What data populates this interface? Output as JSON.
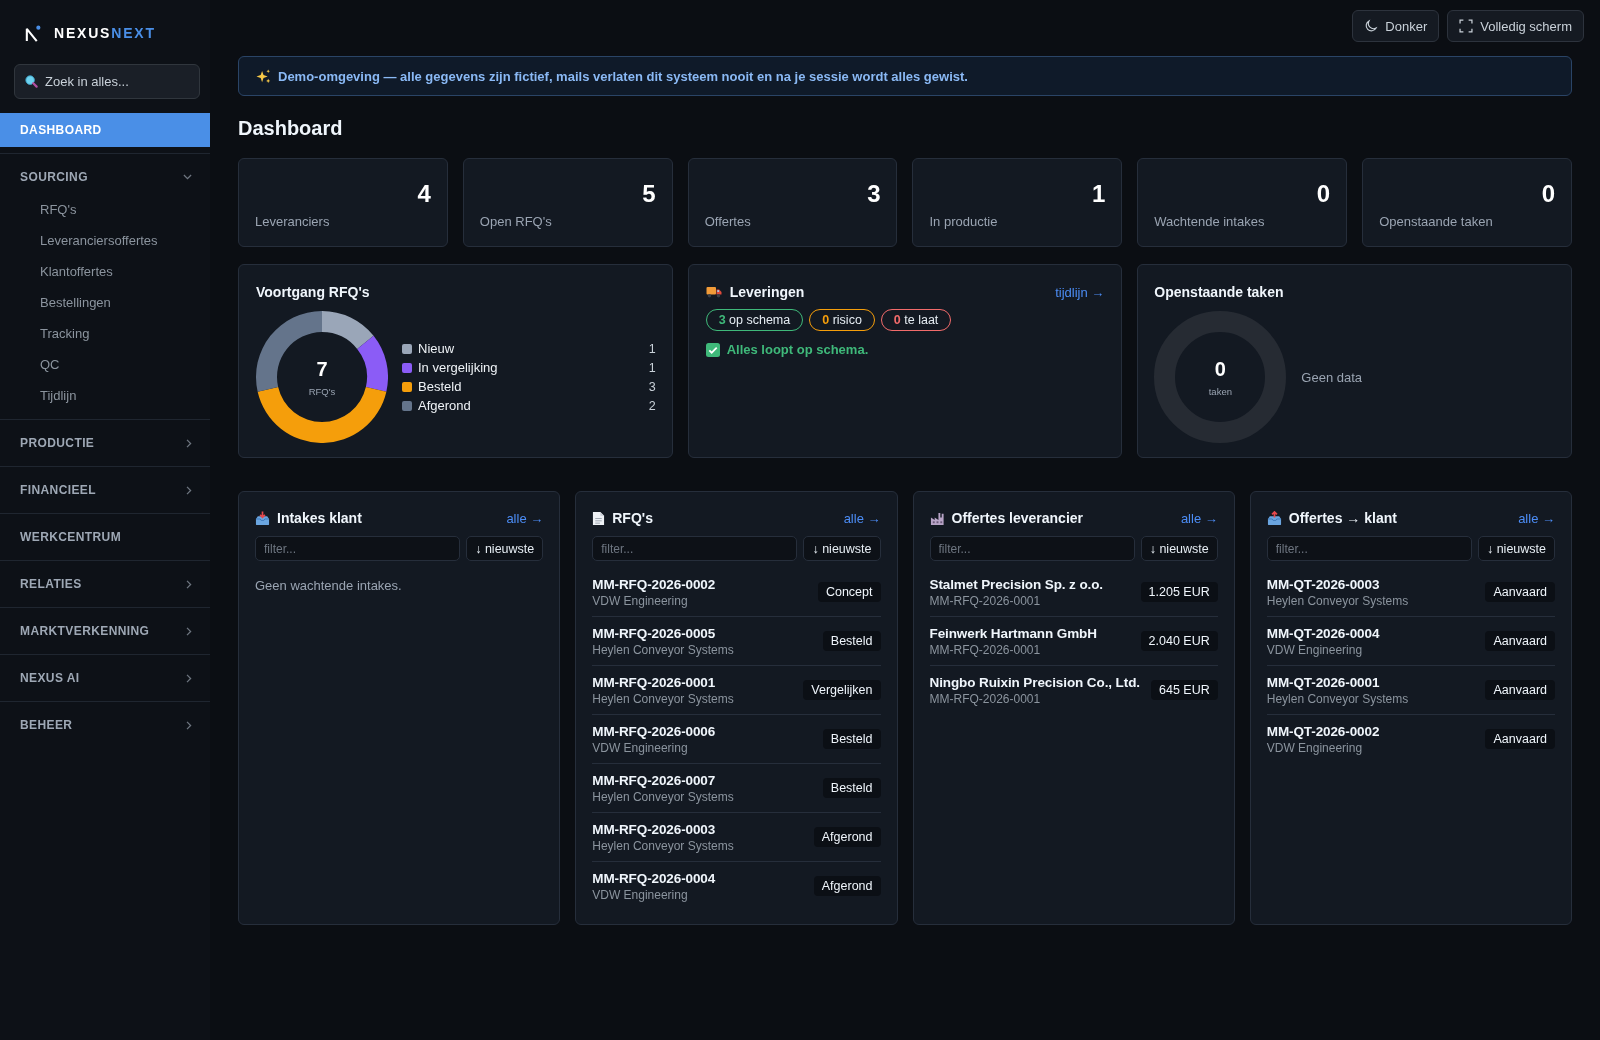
{
  "sidebar": {
    "logo": {
      "primary": "NEXUS",
      "accent": "NEXT"
    },
    "search": {
      "placeholder": "Zoek in alles..."
    },
    "items": [
      {
        "kind": "link",
        "label": "DASHBOARD",
        "selected": true
      },
      {
        "kind": "group",
        "label": "SOURCING",
        "selected": false,
        "expanded": true,
        "children": [
          {
            "label": "RFQ's",
            "selected": false
          },
          {
            "label": "Leveranciersoffertes",
            "selected": false
          },
          {
            "label": "Klantoffertes",
            "selected": false
          },
          {
            "label": "Bestellingen",
            "selected": false
          },
          {
            "label": "Tracking",
            "selected": false
          },
          {
            "label": "QC",
            "selected": false
          },
          {
            "label": "Tijdlijn",
            "selected": false
          }
        ]
      },
      {
        "kind": "group",
        "label": "PRODUCTIE",
        "selected": false,
        "expanded": false
      },
      {
        "kind": "group",
        "label": "FINANCIEEL",
        "selected": false,
        "expanded": false
      },
      {
        "kind": "link",
        "label": "WERKCENTRUM",
        "selected": false
      },
      {
        "kind": "group",
        "label": "RELATIES",
        "selected": false,
        "expanded": false
      },
      {
        "kind": "group",
        "label": "MARKTVERKENNING",
        "selected": false,
        "expanded": false
      },
      {
        "kind": "group",
        "label": "NEXUS AI",
        "selected": false,
        "expanded": false
      },
      {
        "kind": "group",
        "label": "BEHEER",
        "selected": false,
        "expanded": false
      }
    ]
  },
  "top_bar": {
    "buttons": [
      {
        "kind": "theme",
        "label": "Donker"
      },
      {
        "kind": "fullscreen",
        "label": "Volledig scherm"
      }
    ]
  },
  "banner": {
    "text": "Demo-omgeving — alle gegevens zijn fictief, mails verlaten dit systeem nooit en na je sessie wordt alles gewist."
  },
  "page_title": "Dashboard",
  "stats": [
    {
      "value": "4",
      "label": "Leveranciers"
    },
    {
      "value": "5",
      "label": "Open RFQ's"
    },
    {
      "value": "3",
      "label": "Offertes"
    },
    {
      "value": "1",
      "label": "In productie"
    },
    {
      "value": "0",
      "label": "Wachtende intakes"
    },
    {
      "value": "0",
      "label": "Openstaande taken"
    }
  ],
  "rfq_progress": {
    "title": "Voortgang RFQ's",
    "center_value": "7",
    "center_label": "RFQ's",
    "legend": [
      {
        "count": "1",
        "color": "#9aa6b8"
      },
      {
        "count": "1",
        "color": "#8b5cf6"
      },
      {
        "count": "3",
        "color": "#f59e0b"
      },
      {
        "count": "2",
        "color": "#64748b"
      }
    ],
    "chart_data": {
      "type": "donut",
      "categories": [
        "Nieuw",
        "In vergelijking",
        "Besteld",
        "Afgerond"
      ],
      "values": [
        14.28,
        14.28,
        42.86,
        28.58
      ]
    }
  },
  "deliveries": {
    "title": "Leveringen",
    "link": "tijdlijn →",
    "counts": [
      {
        "number": "3",
        "label": "op schema",
        "color": "#3fb97a"
      },
      {
        "number": "0",
        "label": "risico",
        "color": "#f59e0b"
      },
      {
        "number": "0",
        "label": "te laat",
        "color": "#f26b6b"
      }
    ],
    "status": "Alles loopt op schema."
  },
  "open_tasks": {
    "title": "Openstaande taken",
    "center_value": "0",
    "center_label": "taken",
    "empty_text": "Geen data"
  },
  "lists": [
    {
      "kind": "intakes",
      "title": "Intakes klant",
      "link": "alle →",
      "filter": {
        "placeholder": "filter..."
      },
      "sort": "↓ nieuwste",
      "empty_text": "Geen wachtende intakes."
    },
    {
      "kind": "rfqs",
      "title": "RFQ's",
      "link": "alle →",
      "filter": {
        "placeholder": "filter..."
      },
      "sort": "↓ nieuwste",
      "rows": [
        {
          "title": "MM-RFQ-2026-0002",
          "subtitle": "VDW Engineering",
          "status": "Concept"
        },
        {
          "title": "MM-RFQ-2026-0005",
          "subtitle": "Heylen Conveyor Systems",
          "status": "Besteld"
        },
        {
          "title": "MM-RFQ-2026-0001",
          "subtitle": "Heylen Conveyor Systems",
          "status": "Vergelijken"
        },
        {
          "title": "MM-RFQ-2026-0006",
          "subtitle": "VDW Engineering",
          "status": "Besteld"
        },
        {
          "title": "MM-RFQ-2026-0007",
          "subtitle": "Heylen Conveyor Systems",
          "status": "Besteld"
        },
        {
          "title": "MM-RFQ-2026-0003",
          "subtitle": "Heylen Conveyor Systems",
          "status": "Afgerond"
        },
        {
          "title": "MM-RFQ-2026-0004",
          "subtitle": "VDW Engineering",
          "status": "Afgerond"
        }
      ]
    },
    {
      "kind": "supplier_quotes",
      "title": "Offertes leverancier",
      "link": "alle →",
      "filter": {
        "placeholder": "filter..."
      },
      "sort": "↓ nieuwste",
      "rows": [
        {
          "title": "Stalmet Precision Sp. z o.o.",
          "subtitle": "MM-RFQ-2026-0001",
          "amount": "1.205 EUR"
        },
        {
          "title": "Feinwerk Hartmann GmbH",
          "subtitle": "MM-RFQ-2026-0001",
          "amount": "2.040 EUR"
        },
        {
          "title": "Ningbo Ruixin Precision Co., Ltd.",
          "subtitle": "MM-RFQ-2026-0001",
          "amount": "645 EUR"
        }
      ]
    },
    {
      "kind": "customer_quotes",
      "title": "Offertes → klant",
      "link": "alle →",
      "filter": {
        "placeholder": "filter..."
      },
      "sort": "↓ nieuwste",
      "rows": [
        {
          "title": "MM-QT-2026-0003",
          "subtitle": "Heylen Conveyor Systems",
          "status": "Aanvaard"
        },
        {
          "title": "MM-QT-2026-0004",
          "subtitle": "VDW Engineering",
          "status": "Aanvaard"
        },
        {
          "title": "MM-QT-2026-0001",
          "subtitle": "Heylen Conveyor Systems",
          "status": "Aanvaard"
        },
        {
          "title": "MM-QT-2026-0002",
          "subtitle": "VDW Engineering",
          "status": "Aanvaard"
        }
      ]
    }
  ]
}
